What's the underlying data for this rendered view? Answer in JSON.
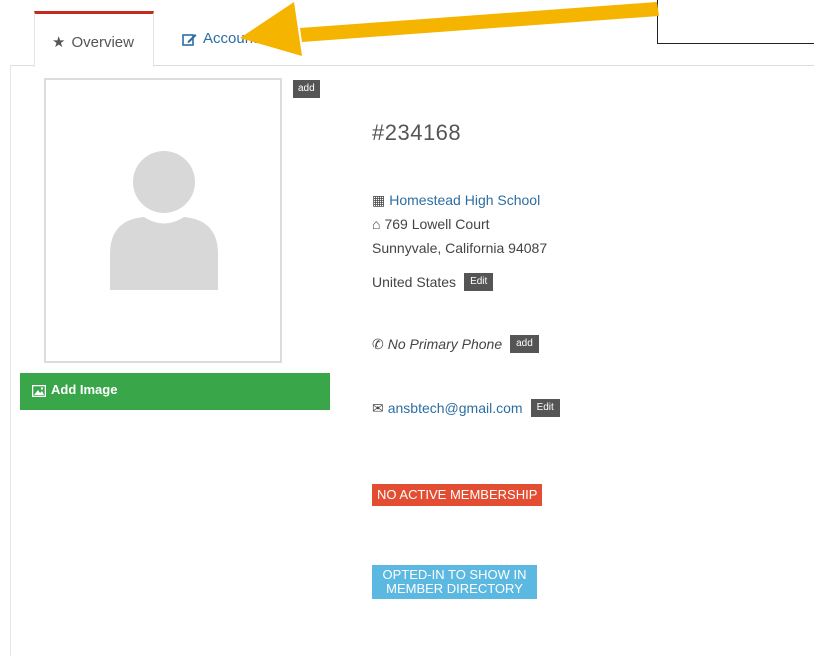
{
  "tabs": {
    "overview": {
      "label": "Overview",
      "icon": "star-icon",
      "active": true
    },
    "account": {
      "label": "Account",
      "icon": "edit-icon"
    }
  },
  "photo": {
    "add_label": "add",
    "add_image_label": "Add Image",
    "add_image_icon": "image-icon"
  },
  "member": {
    "id": "#234168",
    "school": "Homestead High School",
    "street": "769 Lowell Court",
    "city_line": "Sunnyvale, California 94087",
    "country": "United States",
    "address_edit_label": "Edit",
    "phone": "No Primary Phone",
    "phone_add_label": "add",
    "email": "ansbtech@gmail.com",
    "email_edit_label": "Edit"
  },
  "badges": {
    "membership": "NO ACTIVE MEMBERSHIP",
    "directory_line1": "OPTED-IN TO SHOW IN",
    "directory_line2": "MEMBER DIRECTORY"
  },
  "colors": {
    "active_tab_accent": "#c42b1c",
    "link": "#2c6ea3",
    "add_image_green": "#3aa64a",
    "membership_red": "#e34e33",
    "directory_blue": "#5bb8e0",
    "annotation_arrow": "#f5b400"
  }
}
